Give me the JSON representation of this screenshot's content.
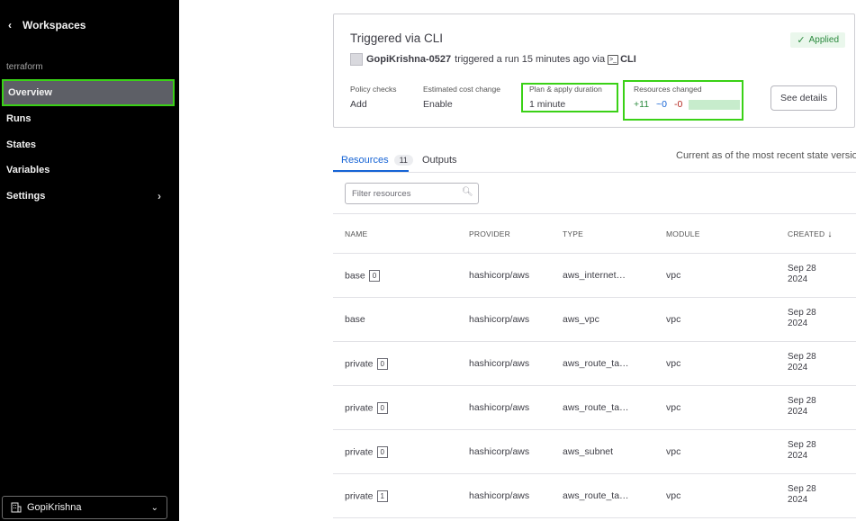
{
  "sidebar": {
    "back_label": "Workspaces",
    "section_label": "terraform",
    "items": [
      {
        "label": "Overview",
        "active": true
      },
      {
        "label": "Runs"
      },
      {
        "label": "States"
      },
      {
        "label": "Variables"
      },
      {
        "label": "Settings",
        "has_submenu": true
      }
    ],
    "org_label": "GopiKrishna"
  },
  "run": {
    "title": "Triggered via CLI",
    "user": "GopiKrishna-0527",
    "action_text": "triggered a run 15 minutes ago via",
    "via": "CLI",
    "status": "Applied",
    "meta": {
      "policy_label": "Policy checks",
      "policy_value": "Add",
      "cost_label": "Estimated cost change",
      "cost_value": "Enable",
      "duration_label": "Plan & apply duration",
      "duration_value": "1 minute",
      "changed_label": "Resources changed",
      "added": "+11",
      "changed": "~0",
      "destroyed": "-0"
    },
    "details_label": "See details"
  },
  "tabs": {
    "resources_label": "Resources",
    "resources_count": "11",
    "outputs_label": "Outputs",
    "state_note": "Current as of the most recent state version."
  },
  "filter": {
    "placeholder": "Filter resources"
  },
  "table": {
    "headers": {
      "name": "NAME",
      "provider": "PROVIDER",
      "type": "TYPE",
      "module": "MODULE",
      "created": "CREATED"
    },
    "rows": [
      {
        "name": "base",
        "index": "0",
        "provider": "hashicorp/aws",
        "type": "aws_internet…",
        "module": "vpc",
        "created_1": "Sep 28",
        "created_2": "2024"
      },
      {
        "name": "base",
        "index": "",
        "provider": "hashicorp/aws",
        "type": "aws_vpc",
        "module": "vpc",
        "created_1": "Sep 28",
        "created_2": "2024"
      },
      {
        "name": "private",
        "index": "0",
        "provider": "hashicorp/aws",
        "type": "aws_route_ta…",
        "module": "vpc",
        "created_1": "Sep 28",
        "created_2": "2024"
      },
      {
        "name": "private",
        "index": "0",
        "provider": "hashicorp/aws",
        "type": "aws_route_ta…",
        "module": "vpc",
        "created_1": "Sep 28",
        "created_2": "2024"
      },
      {
        "name": "private",
        "index": "0",
        "provider": "hashicorp/aws",
        "type": "aws_subnet",
        "module": "vpc",
        "created_1": "Sep 28",
        "created_2": "2024"
      },
      {
        "name": "private",
        "index": "1",
        "provider": "hashicorp/aws",
        "type": "aws_route_ta…",
        "module": "vpc",
        "created_1": "Sep 28",
        "created_2": "2024"
      }
    ]
  },
  "colors": {
    "sidebar_bg": "#000000",
    "highlight": "#3ad116",
    "link_blue": "#1563d5",
    "applied_green": "#2b8a3e"
  }
}
